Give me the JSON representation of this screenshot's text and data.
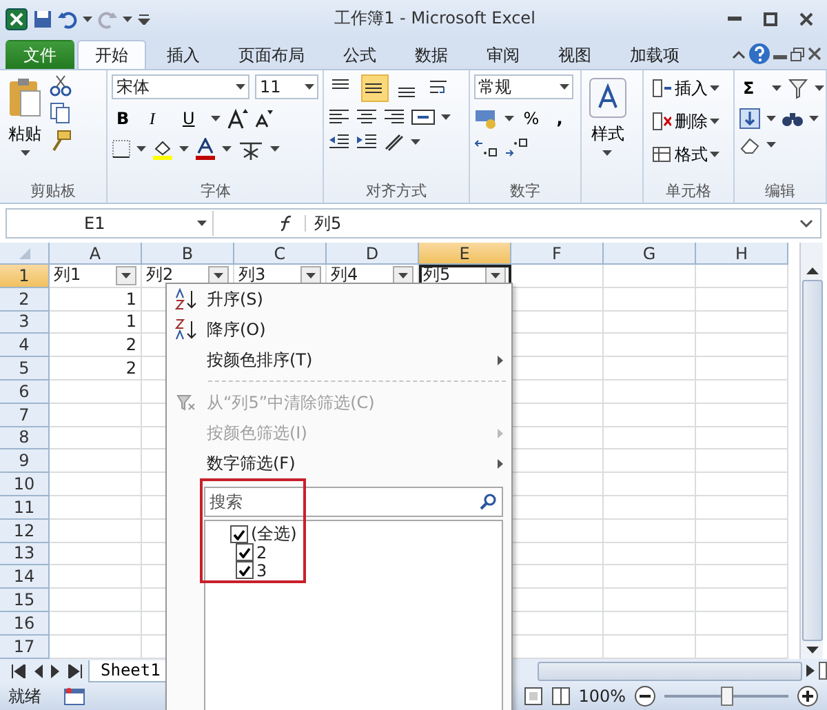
{
  "window": {
    "title": "工作簿1 - Microsoft Excel"
  },
  "ribbon_tabs": [
    {
      "label": "文件",
      "kind": "file",
      "selected": false
    },
    {
      "label": "开始",
      "kind": "tab",
      "selected": true
    },
    {
      "label": "插入",
      "kind": "tab",
      "selected": false
    },
    {
      "label": "页面布局",
      "kind": "tab",
      "selected": false
    },
    {
      "label": "公式",
      "kind": "tab",
      "selected": false
    },
    {
      "label": "数据",
      "kind": "tab",
      "selected": false
    },
    {
      "label": "审阅",
      "kind": "tab",
      "selected": false
    },
    {
      "label": "视图",
      "kind": "tab",
      "selected": false
    },
    {
      "label": "加载项",
      "kind": "tab",
      "selected": false
    }
  ],
  "ribbon": {
    "clipboard": {
      "label": "剪贴板",
      "paste": "粘贴"
    },
    "font": {
      "label": "字体",
      "face": "宋体",
      "size": "11",
      "bold": "B",
      "italic": "I",
      "underline": "U"
    },
    "alignment": {
      "label": "对齐方式",
      "vertical_align": [
        {
          "kind": "top",
          "selected": false
        },
        {
          "kind": "middle",
          "selected": true
        },
        {
          "kind": "bottom",
          "selected": false
        }
      ]
    },
    "number": {
      "label": "数字",
      "format": "常规",
      "percent": "%",
      "comma": ","
    },
    "styles": {
      "button": "样式"
    },
    "cells": {
      "label": "单元格",
      "insert": "插入",
      "delete": "删除",
      "format": "格式"
    },
    "editing": {
      "label": "编辑",
      "sum": "Σ"
    }
  },
  "formula_bar": {
    "name_box": "E1",
    "formula": "列5"
  },
  "columns": [
    {
      "label": "A",
      "selected": false
    },
    {
      "label": "B",
      "selected": false
    },
    {
      "label": "C",
      "selected": false
    },
    {
      "label": "D",
      "selected": false
    },
    {
      "label": "E",
      "selected": true
    },
    {
      "label": "F",
      "selected": false
    },
    {
      "label": "G",
      "selected": false
    },
    {
      "label": "H",
      "selected": false
    }
  ],
  "rows": [
    {
      "number": "1",
      "selected": true,
      "cells": [
        {
          "value": "列1",
          "filter": true,
          "active": false
        },
        {
          "value": "列2",
          "filter": true,
          "active": false
        },
        {
          "value": "列3",
          "filter": true,
          "active": false
        },
        {
          "value": "列4",
          "filter": true,
          "active": false
        },
        {
          "value": "列5",
          "filter": true,
          "active": true
        }
      ]
    },
    {
      "number": "2",
      "selected": false,
      "cells": [
        {
          "value": "1",
          "filter": false,
          "active": false
        }
      ]
    },
    {
      "number": "3",
      "selected": false,
      "cells": [
        {
          "value": "1",
          "filter": false,
          "active": false
        }
      ]
    },
    {
      "number": "4",
      "selected": false,
      "cells": [
        {
          "value": "2",
          "filter": false,
          "active": false
        }
      ]
    },
    {
      "number": "5",
      "selected": false,
      "cells": [
        {
          "value": "2",
          "filter": false,
          "active": false
        }
      ]
    },
    {
      "number": "6",
      "selected": false,
      "cells": []
    },
    {
      "number": "7",
      "selected": false,
      "cells": []
    },
    {
      "number": "8",
      "selected": false,
      "cells": []
    },
    {
      "number": "9",
      "selected": false,
      "cells": []
    },
    {
      "number": "10",
      "selected": false,
      "cells": []
    },
    {
      "number": "11",
      "selected": false,
      "cells": []
    },
    {
      "number": "12",
      "selected": false,
      "cells": []
    },
    {
      "number": "13",
      "selected": false,
      "cells": []
    },
    {
      "number": "14",
      "selected": false,
      "cells": []
    },
    {
      "number": "15",
      "selected": false,
      "cells": []
    },
    {
      "number": "16",
      "selected": false,
      "cells": []
    },
    {
      "number": "17",
      "selected": false,
      "cells": []
    }
  ],
  "filter_menu": {
    "items": [
      {
        "label": "升序(S)",
        "kind": "sort_ascending",
        "disabled": false
      },
      {
        "label": "降序(O)",
        "kind": "sort_descending",
        "disabled": false
      },
      {
        "label": "按颜色排序(T)",
        "kind": "submenu",
        "disabled": false
      },
      {
        "label": "从“列5”中清除筛选(C)",
        "kind": "clear_filter",
        "disabled": true
      },
      {
        "label": "按颜色筛选(I)",
        "kind": "submenu",
        "disabled": true
      },
      {
        "label": "数字筛选(F)",
        "kind": "submenu",
        "disabled": false
      }
    ],
    "search": {
      "placeholder": "搜索"
    },
    "values": [
      {
        "label": "(全选)",
        "checked": true
      },
      {
        "label": "2",
        "checked": true
      },
      {
        "label": "3",
        "checked": true
      }
    ]
  },
  "sheet_tabs": [
    {
      "label": "Sheet1",
      "selected": true
    }
  ],
  "status_bar": {
    "status": "就绪",
    "zoom": "100%",
    "zoom_level": {
      "level": 0.5
    }
  }
}
